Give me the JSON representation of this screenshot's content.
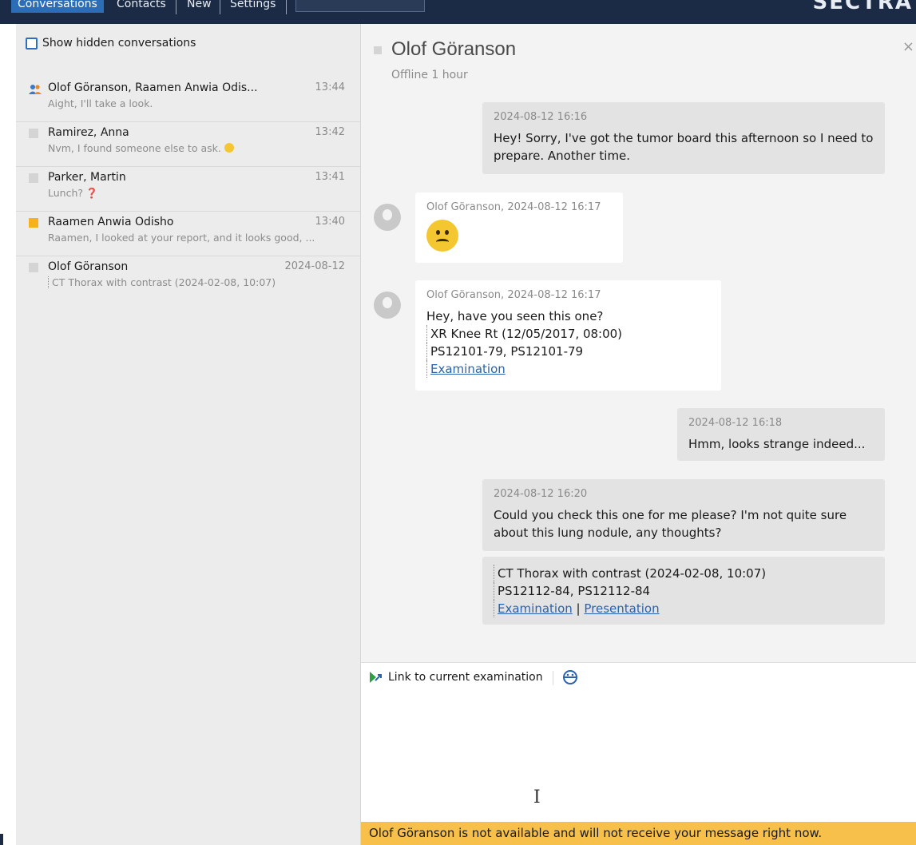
{
  "nav": {
    "tabs": [
      "Conversations",
      "Contacts",
      "New",
      "Settings"
    ],
    "brand": "SECTRA"
  },
  "sidebar": {
    "show_hidden_label": "Show hidden conversations",
    "conversations": [
      {
        "name": "Olof Göranson, Raamen Anwia Odis...",
        "time": "13:44",
        "preview": "Aight, I'll take a look.",
        "indicator": "group"
      },
      {
        "name": "Ramirez, Anna",
        "time": "13:42",
        "preview": "Nvm, I found someone else to ask.",
        "indicator": "gray"
      },
      {
        "name": "Parker, Martin",
        "time": "13:41",
        "preview": "Lunch?",
        "indicator": "gray"
      },
      {
        "name": "Raamen Anwia Odisho",
        "time": "13:40",
        "preview": "Raamen, I looked at your report, and it looks good, ...",
        "indicator": "orange"
      },
      {
        "name": "Olof Göranson",
        "time": "2024-08-12",
        "preview": "CT Thorax with contrast (2024-02-08, 10:07)",
        "indicator": "gray"
      }
    ]
  },
  "chat": {
    "title": "Olof Göranson",
    "status": "Offline 1 hour",
    "messages": [
      {
        "direction": "out",
        "meta": "2024-08-12 16:16",
        "text": "Hey! Sorry, I've got the tumor board this afternoon so I need to prepare. Another time."
      },
      {
        "direction": "in",
        "meta": "Olof Göranson, 2024-08-12 16:17",
        "emoji": "sad-face"
      },
      {
        "direction": "in",
        "meta": "Olof Göranson, 2024-08-12 16:17",
        "text": "Hey, have you seen this one?",
        "exam": "XR Knee Rt (12/05/2017, 08:00)",
        "ids": "PS12101-79, PS12101-79",
        "link": "Examination"
      },
      {
        "direction": "out",
        "meta": "2024-08-12 16:18",
        "text": "Hmm, looks strange indeed..."
      },
      {
        "direction": "out",
        "meta": "2024-08-12 16:20",
        "text": "Could you check this one for me please? I'm not quite sure about this lung nodule, any thoughts?",
        "exam": "CT Thorax with contrast (2024-02-08, 10:07)",
        "ids": "PS12112-84, PS12112-84",
        "link": "Examination",
        "link2": "Presentation",
        "link_sep": "|"
      }
    ]
  },
  "compose": {
    "link_label": "Link to current examination"
  },
  "warning": "Olof Göranson is not available and will not receive your message right now.",
  "colors": {
    "nav_bg": "#1b2b45",
    "accent": "#2c6db7",
    "warning_bg": "#f6c04b",
    "unread": "#f6b21d"
  }
}
